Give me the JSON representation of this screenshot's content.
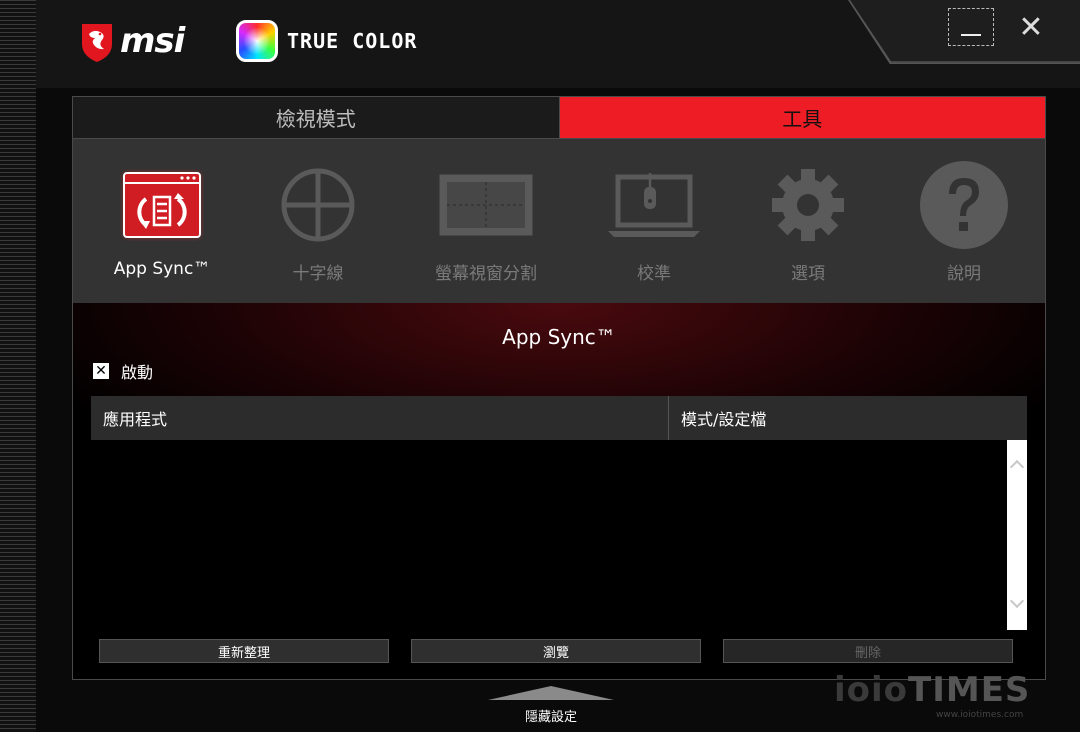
{
  "brand": {
    "msi": "msi",
    "product": "TRUE COLOR"
  },
  "window": {
    "minimize": "",
    "close": "✕"
  },
  "tabs": [
    {
      "label": "檢視模式",
      "active": false
    },
    {
      "label": "工具",
      "active": true
    }
  ],
  "tools": [
    {
      "label": "App Sync™",
      "icon": "app-sync-icon",
      "active": true
    },
    {
      "label": "十字線",
      "icon": "crosshair-icon",
      "active": false
    },
    {
      "label": "螢幕視窗分割",
      "icon": "screen-split-icon",
      "active": false
    },
    {
      "label": "校準",
      "icon": "calibration-icon",
      "active": false
    },
    {
      "label": "選項",
      "icon": "gear-icon",
      "active": false
    },
    {
      "label": "說明",
      "icon": "help-icon",
      "active": false
    }
  ],
  "content": {
    "title": "App Sync™",
    "enable_label": "啟動",
    "enable_checked": true,
    "table": {
      "headers": [
        "應用程式",
        "模式/設定檔"
      ],
      "rows": []
    }
  },
  "buttons": {
    "refresh": "重新整理",
    "browse": "瀏覽",
    "delete": "刪除"
  },
  "footer": {
    "hide_settings": "隱藏設定"
  },
  "watermark": {
    "main_a": "ioio",
    "main_b": "TIMES",
    "url": "www.ioiotimes.com"
  },
  "colors": {
    "accent": "#ee1c24",
    "panel": "#333333",
    "background": "#000000"
  }
}
